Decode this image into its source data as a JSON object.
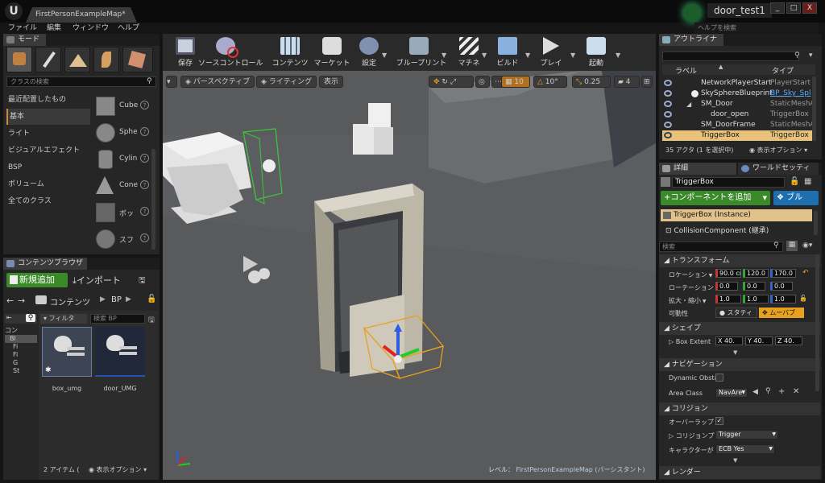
{
  "title_bar": {
    "logo": "U",
    "map_tab": "FirstPersonExampleMap*",
    "project_name": "door_test1",
    "help_search_placeholder": "ヘルプを検索",
    "window_buttons": [
      "_",
      "□",
      "X"
    ]
  },
  "menu": [
    "ファイル",
    "編集",
    "ウィンドウ",
    "ヘルプ"
  ],
  "modes_panel": {
    "tab": "モード",
    "search_placeholder": "クラスの検索",
    "categories": [
      "最近配置したもの",
      "基本",
      "ライト",
      "ビジュアルエフェクト",
      "BSP",
      "ボリューム",
      "全てのクラス"
    ],
    "selected_category": "基本",
    "placeables": [
      "Cube",
      "Sphe",
      "Cylin",
      "Cone",
      "ボッ",
      "スフ"
    ]
  },
  "toolbar": {
    "buttons": [
      "保存",
      "ソースコントロール",
      "コンテンツ",
      "マーケット",
      "設定",
      "ブループリント",
      "マチネ",
      "ビルド",
      "プレイ",
      "起動"
    ]
  },
  "viewport": {
    "perspective": "パースペクティブ",
    "lighting": "ライティング",
    "show": "表示",
    "grid_snap": "10",
    "rotation_snap": "10°",
    "scale_snap": "0.25",
    "camera_speed": "4",
    "level_label": "レベル：",
    "level_name": "FirstPersonExampleMap (パーシスタント)"
  },
  "content_browser": {
    "tab": "コンテンツブラウザ",
    "add_new": "新規追加",
    "import": "インポート",
    "path": [
      "コンテンツ",
      "BP"
    ],
    "filter": "フィルタ",
    "search_placeholder": "検索 BP",
    "tree": [
      "コン",
      "Bl",
      "Fi",
      "Fi",
      "",
      "",
      "G",
      "St"
    ],
    "assets": [
      "box_umg",
      "door_UMG"
    ],
    "item_count": "2 アイテム (",
    "view_options": "表示オプション"
  },
  "outliner": {
    "tab": "アウトライナ",
    "search_placeholder": "",
    "col_label": "ラベル",
    "col_type": "タイプ",
    "rows": [
      {
        "name": "NetworkPlayerStart",
        "type": "PlayerStart"
      },
      {
        "name": "SkySphereBlueprint",
        "type": "BP_Sky_Spl"
      },
      {
        "name": "SM_Door",
        "type": "StaticMeshA"
      },
      {
        "name": "door_open",
        "type": "TriggerBox"
      },
      {
        "name": "SM_DoorFrame",
        "type": "StaticMeshA"
      },
      {
        "name": "TriggerBox",
        "type": "TriggerBox"
      }
    ],
    "actor_count": "35 アクタ (1 を選択中)",
    "view_options": "表示オプション"
  },
  "details": {
    "tab_details": "詳細",
    "tab_world": "ワールドセッティ",
    "name": "TriggerBox",
    "add_component": "+コンポーネントを追加",
    "blueprint": "ブル",
    "instance": "TriggerBox (Instance)",
    "component": "CollisionComponent (継承)",
    "search_placeholder": "検索",
    "transform_header": "トランスフォーム",
    "location_label": "ロケーション",
    "location": [
      "90.0 cm",
      "120.0 c",
      "170.0 c"
    ],
    "rotation_label": "ローテーション",
    "rotation": [
      "0.0",
      "0.0",
      "0.0"
    ],
    "scale_label": "拡大・縮小",
    "scale": [
      "1.0",
      "1.0",
      "1.0"
    ],
    "mobility_label": "可動性",
    "mobility_static": "スタティ",
    "mobility_movable": "ムーバブ",
    "shape_header": "シェイプ",
    "box_extent_label": "Box Extent",
    "box_extent": [
      "X 40.",
      "Y 40.",
      "Z 40."
    ],
    "navigation_header": "ナビゲーション",
    "dynamic_obstacle_label": "Dynamic Obsta",
    "area_class_label": "Area Class",
    "area_class_value": "NavAre",
    "collision_header": "コリジョン",
    "overlap_label": "オーバーラップ",
    "collision_preset_label": "コリジョンプリ",
    "collision_preset_value": "Trigger",
    "character_label": "キャラクターが",
    "character_value": "ECB Yes",
    "render_header": "レンダー"
  }
}
